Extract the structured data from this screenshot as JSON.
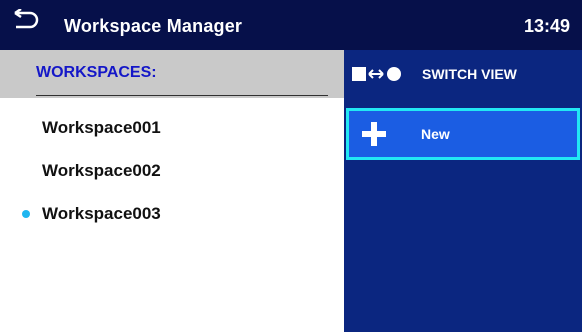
{
  "header": {
    "back_icon": "back-arrow-icon",
    "title": "Workspace Manager",
    "time": "13:49"
  },
  "list": {
    "heading": "WORKSPACES:",
    "items": [
      {
        "label": "Workspace001",
        "active": false
      },
      {
        "label": "Workspace002",
        "active": false
      },
      {
        "label": "Workspace003",
        "active": true
      }
    ]
  },
  "actions": {
    "switch_view": {
      "label": "SWITCH VIEW",
      "icon": "switch-view-icon"
    },
    "new": {
      "label": "New",
      "icon": "plus-icon",
      "selected": true
    }
  },
  "colors": {
    "title_bar": "#06104a",
    "action_panel": "#0b2680",
    "selected_button": "#1b5de3",
    "selection_border": "#22e8f4",
    "heading_text": "#1417c8",
    "active_dot": "#1fb6f0"
  }
}
